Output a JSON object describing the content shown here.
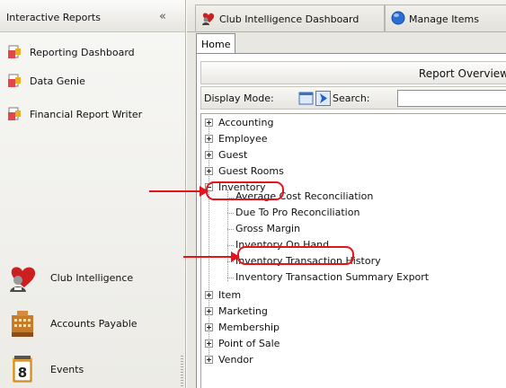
{
  "left_pane": {
    "title": "Interactive Reports",
    "collapse_glyph": "«",
    "top_items": [
      {
        "label": "Reporting Dashboard",
        "icon": "report-doc-icon"
      },
      {
        "label": "Data Genie",
        "icon": "report-doc-icon"
      },
      {
        "label": "Financial Report Writer",
        "icon": "report-doc-icon"
      }
    ],
    "bottom_items": [
      {
        "label": "Club Intelligence",
        "icon": "heart-user-icon"
      },
      {
        "label": "Accounts Payable",
        "icon": "building-icon"
      },
      {
        "label": "Events",
        "icon": "calendar-icon"
      }
    ]
  },
  "doc_tabs": [
    {
      "label": "Club Intelligence Dashboard",
      "icon": "heart-user-icon"
    },
    {
      "label": "Manage Items",
      "icon": "globe-icon"
    }
  ],
  "home_tab": "Home",
  "report": {
    "title": "Report Overview",
    "display_mode_label": "Display Mode:",
    "search_label": "Search:",
    "search_value": ""
  },
  "tree": {
    "items": [
      {
        "label": "Accounting",
        "state": "collapsed"
      },
      {
        "label": "Employee",
        "state": "collapsed"
      },
      {
        "label": "Guest",
        "state": "collapsed"
      },
      {
        "label": "Guest Rooms",
        "state": "collapsed"
      },
      {
        "label": "Inventory",
        "state": "expanded"
      },
      {
        "label": "Average Cost Reconciliation",
        "state": "leaf"
      },
      {
        "label": "Due To Pro Reconciliation",
        "state": "leaf"
      },
      {
        "label": "Gross Margin",
        "state": "leaf"
      },
      {
        "label": "Inventory On Hand",
        "state": "leaf"
      },
      {
        "label": "Inventory Transaction History",
        "state": "leaf"
      },
      {
        "label": "Inventory Transaction Summary Export",
        "state": "leaf"
      },
      {
        "label": "Item",
        "state": "collapsed"
      },
      {
        "label": "Marketing",
        "state": "collapsed"
      },
      {
        "label": "Membership",
        "state": "collapsed"
      },
      {
        "label": "Point of Sale",
        "state": "collapsed"
      },
      {
        "label": "Vendor",
        "state": "collapsed"
      }
    ]
  },
  "colors": {
    "annotation": "#e3141b",
    "accent_blue": "#2a6fd6"
  }
}
